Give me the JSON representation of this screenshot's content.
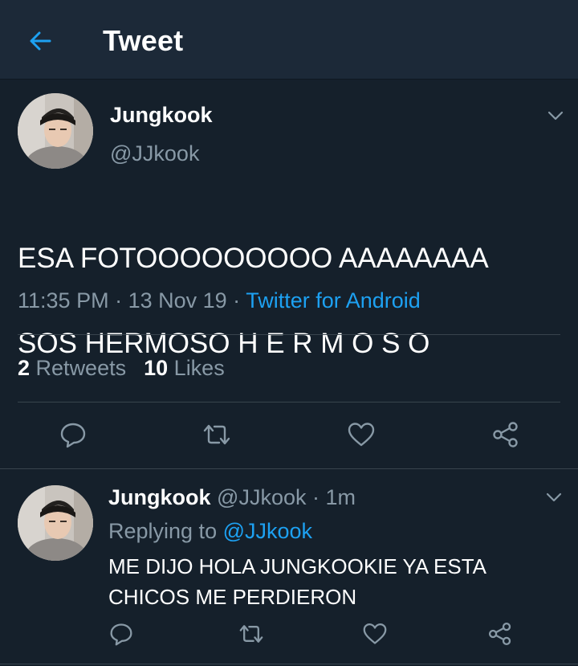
{
  "header": {
    "title": "Tweet",
    "back_icon": "arrow-left-icon"
  },
  "colors": {
    "background": "#15202b",
    "header_background": "#1c2938",
    "accent": "#1da1f2",
    "muted_text": "#8899a6",
    "divider": "#38444d"
  },
  "tweet": {
    "author_name": "Jungkook",
    "author_handle": "@JJkook",
    "text_line1": "ESA FOTOOOOOOOOO AAAAAAAA",
    "text_line2": "SOS HERMOSO H E R M O S O",
    "time": "11:35 PM",
    "separator": " · ",
    "date": "13 Nov 19",
    "source": "Twitter for Android",
    "retweet_count": "2",
    "retweet_label": "Retweets",
    "like_count": "10",
    "like_label": "Likes",
    "menu_icon": "chevron-down-icon",
    "actions": [
      "reply-icon",
      "retweet-icon",
      "like-icon",
      "share-icon"
    ]
  },
  "reply": {
    "author_name": "Jungkook",
    "author_handle": "@JJkook",
    "separator": " · ",
    "age": "1m",
    "replying_label": "Replying to",
    "replying_to": "@JJkook",
    "text_line1": "ME DIJO HOLA JUNGKOOKIE YA ESTA",
    "text_line2": "CHICOS ME PERDIERON",
    "menu_icon": "chevron-down-icon",
    "actions": [
      "reply-icon",
      "retweet-icon",
      "like-icon",
      "share-icon"
    ]
  }
}
